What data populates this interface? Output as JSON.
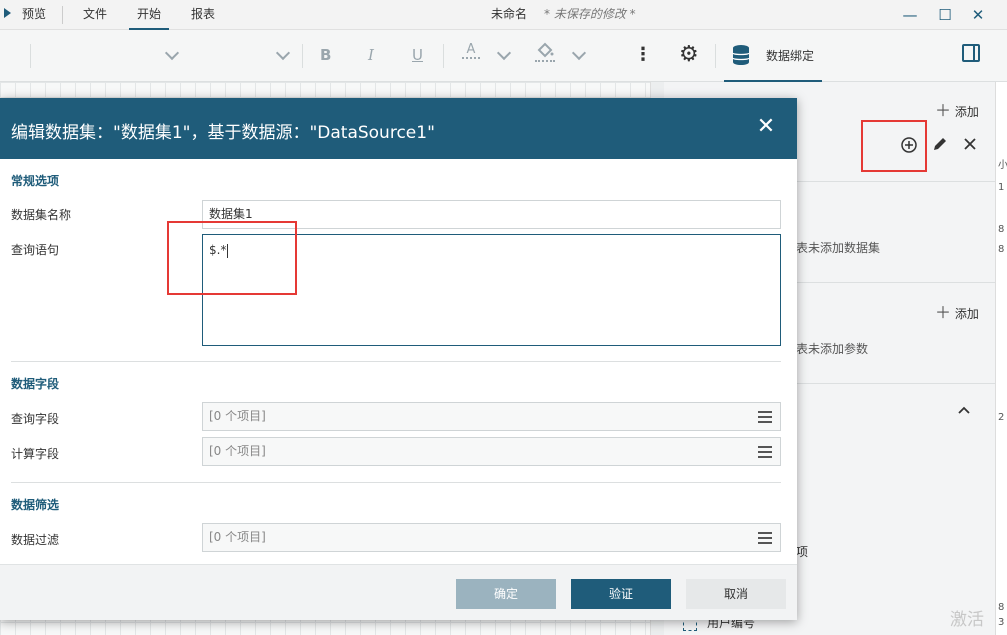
{
  "titlebar": {
    "preview": "预览",
    "file": "文件",
    "home": "开始",
    "report": "报表",
    "doc_title": "未命名",
    "unsaved": "* 未保存的修改 *",
    "minimize": "—",
    "maximize": "☐",
    "close": "✕"
  },
  "toolbar": {
    "bold": "B",
    "italic": "I",
    "underline": "U",
    "font_color": "A",
    "more": "⋮",
    "settings": "⚙",
    "data_binding": "数据绑定"
  },
  "right_panel": {
    "add_dataset": "添加",
    "no_dataset": "表未添加数据集",
    "add_param": "添加",
    "no_param": "表未添加参数",
    "partial_label": "项",
    "user_id": "用户编号",
    "strip_texts": [
      "小",
      "1",
      "8",
      "8",
      "2",
      "8",
      "3"
    ],
    "activate": "激活"
  },
  "dialog": {
    "title": "编辑数据集：\"数据集1\"，基于数据源：\"DataSource1\"",
    "sections": {
      "general": "常规选项",
      "fields": "数据字段",
      "filter": "数据筛选"
    },
    "labels": {
      "dataset_name": "数据集名称",
      "query": "查询语句",
      "query_fields": "查询字段",
      "calc_fields": "计算字段",
      "data_filter": "数据过滤"
    },
    "values": {
      "dataset_name": "数据集1",
      "query": "$.*",
      "query_fields": "[0 个项目]",
      "calc_fields": "[0 个项目]",
      "data_filter": "[0 个项目]"
    },
    "buttons": {
      "ok": "确定",
      "verify": "验证",
      "cancel": "取消"
    }
  },
  "colors": {
    "accent": "#1f5c7a",
    "highlight_box": "#e53935"
  }
}
